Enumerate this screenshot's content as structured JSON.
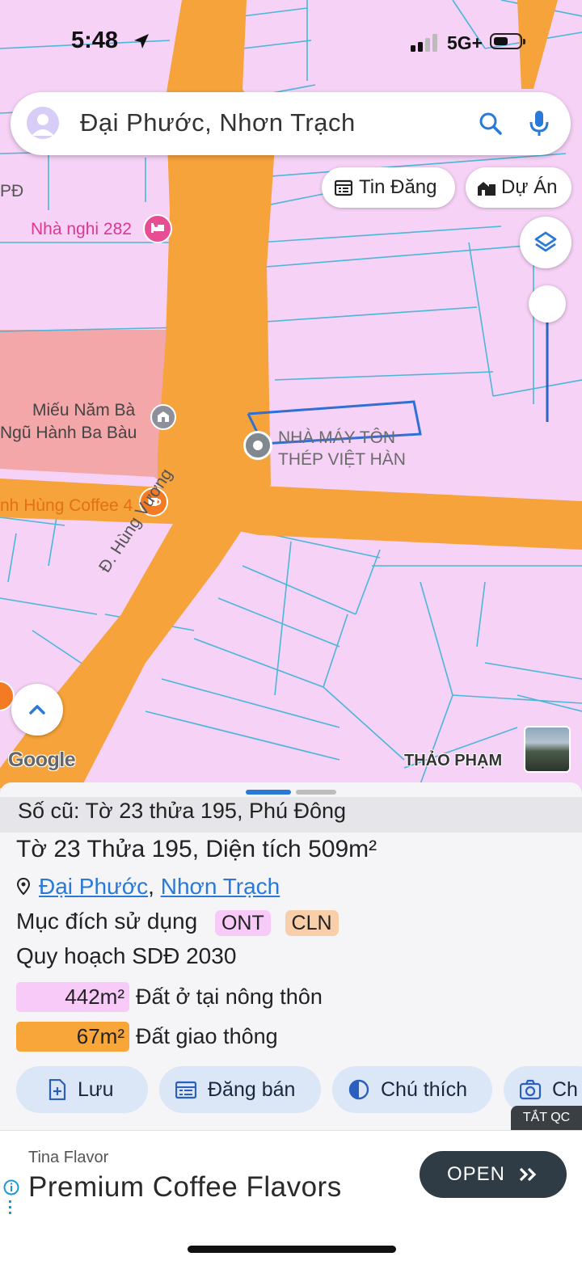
{
  "status_bar": {
    "time": "5:48",
    "network": "5G+"
  },
  "search": {
    "query": "Đại Phước, Nhơn Trạch"
  },
  "top_buttons": {
    "listings": "Tin Đăng",
    "projects": "Dự Án"
  },
  "map": {
    "pois": {
      "guesthouse": "Nhà nghi 282",
      "temple_line1": "Miếu Năm Bà",
      "temple_line2": "Ngũ Hành Ba Bàu",
      "coffee": "nh Hùng Coffee 4",
      "factory_line1": "NHÀ MÁY TÔN",
      "factory_line2": "THÉP VIỆT HÀN",
      "edge_label": "PĐ"
    },
    "road_name": "Đ. Hùng Vương",
    "google_logo": "Google",
    "photo_credit": "THẢO PHẠM"
  },
  "sheet": {
    "old_number": "Số cũ: Tờ 23 thửa 195, Phú Đông",
    "parcel": {
      "prefix": "Tờ ",
      "sheet_no": "23",
      "mid1": " Thửa ",
      "parcel_no": "195",
      "mid2": ", Diện tích ",
      "area": "509",
      "unit": "m²"
    },
    "location": {
      "ward": "Đại Phước",
      "separator": ", ",
      "district": "Nhơn Trạch"
    },
    "usage_label": "Mục đích sử dụng",
    "usage_tags": [
      "ONT",
      "CLN"
    ],
    "plan_label": "Quy hoạch SDĐ 2030",
    "plan_items": [
      {
        "area": "442m²",
        "label": "Đất ở tại nông thôn",
        "color": "#f8caf8"
      },
      {
        "area": "67m²",
        "label": "Đất giao thông",
        "color": "#f8a53a"
      }
    ],
    "actions": [
      "Lưu",
      "Đăng bán",
      "Chú thích",
      "Ch"
    ]
  },
  "ad": {
    "hide_label": "TẮT QC",
    "brand": "Tina Flavor",
    "headline": "Premium Coffee Flavors",
    "cta": "OPEN"
  },
  "colors": {
    "land": "#f6d2f6",
    "road": "#f5a33a",
    "parcel_line": "#4ab6d9",
    "accent": "#2a79d6"
  }
}
